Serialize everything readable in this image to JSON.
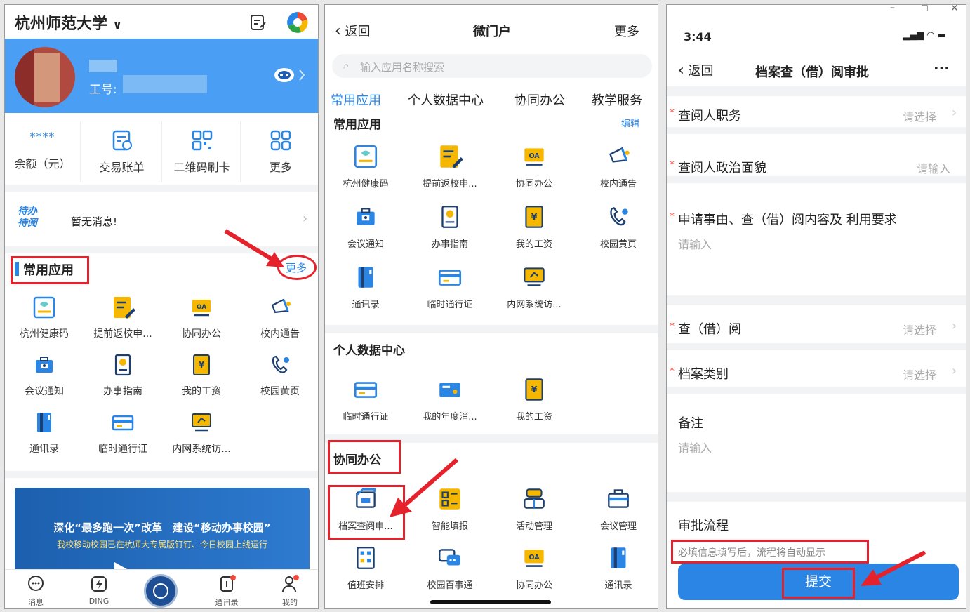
{
  "panel1": {
    "org_name": "杭州师范大学",
    "profile_id_label": "工号:",
    "wallet": [
      {
        "value": "****",
        "label": "余额（元）"
      },
      {
        "icon": "bill-icon",
        "label": "交易账单"
      },
      {
        "icon": "qrcode-icon",
        "label": "二维码刷卡"
      },
      {
        "icon": "grid-icon",
        "label": "更多"
      }
    ],
    "todo_badge_line1": "待办",
    "todo_badge_line2": "待阅",
    "todo_text": "暂无消息!",
    "section_title": "常用应用",
    "more_link": "更多",
    "apps": [
      {
        "label": "杭州健康码",
        "icon": "health-code-icon"
      },
      {
        "label": "提前返校申...",
        "icon": "form-edit-icon"
      },
      {
        "label": "协同办公",
        "icon": "oa-icon"
      },
      {
        "label": "校内通告",
        "icon": "megaphone-icon"
      },
      {
        "label": "会议通知",
        "icon": "briefcase-icon"
      },
      {
        "label": "办事指南",
        "icon": "guide-icon"
      },
      {
        "label": "我的工资",
        "icon": "salary-icon"
      },
      {
        "label": "校园黄页",
        "icon": "phone-icon"
      },
      {
        "label": "通讯录",
        "icon": "contacts-book-icon"
      },
      {
        "label": "临时通行证",
        "icon": "card-icon"
      },
      {
        "label": "内网系统访...",
        "icon": "monitor-icon"
      }
    ],
    "banner_line1": "深化“最多跑一次”改革　建设“移动办事校园”",
    "banner_line2": "我校移动校园已在杭师大专属版钉钉、今日校园上线运行",
    "tabbar": [
      {
        "label": "消息",
        "icon": "message-icon"
      },
      {
        "label": "DING",
        "icon": "ding-icon"
      },
      {
        "label": "",
        "icon": "school-logo-icon"
      },
      {
        "label": "通讯录",
        "icon": "contacts-icon"
      },
      {
        "label": "我的",
        "icon": "profile-icon"
      }
    ]
  },
  "panel2": {
    "back": "返回",
    "title": "微门户",
    "more": "更多",
    "search_placeholder": "输入应用名称搜索",
    "tabs": [
      "常用应用",
      "个人数据中心",
      "协同办公",
      "教学服务"
    ],
    "section1_title": "常用应用",
    "section1_edit": "编辑",
    "section1_apps": [
      {
        "label": "杭州健康码",
        "icon": "health-code-icon"
      },
      {
        "label": "提前返校申...",
        "icon": "form-edit-icon"
      },
      {
        "label": "协同办公",
        "icon": "oa-icon"
      },
      {
        "label": "校内通告",
        "icon": "megaphone-icon"
      },
      {
        "label": "会议通知",
        "icon": "briefcase-icon"
      },
      {
        "label": "办事指南",
        "icon": "guide-icon"
      },
      {
        "label": "我的工资",
        "icon": "salary-icon"
      },
      {
        "label": "校园黄页",
        "icon": "phone-icon"
      },
      {
        "label": "通讯录",
        "icon": "contacts-book-icon"
      },
      {
        "label": "临时通行证",
        "icon": "card-icon"
      },
      {
        "label": "内网系统访...",
        "icon": "monitor-icon"
      }
    ],
    "section2_title": "个人数据中心",
    "section2_apps": [
      {
        "label": "临时通行证",
        "icon": "card-icon"
      },
      {
        "label": "我的年度消...",
        "icon": "consumption-icon"
      },
      {
        "label": "我的工资",
        "icon": "salary-icon"
      }
    ],
    "section3_title": "协同办公",
    "section3_apps": [
      {
        "label": "档案查阅申...",
        "icon": "archive-icon"
      },
      {
        "label": "智能填报",
        "icon": "smart-form-icon"
      },
      {
        "label": "活动管理",
        "icon": "activity-icon"
      },
      {
        "label": "会议管理",
        "icon": "meeting-icon"
      },
      {
        "label": "值班安排",
        "icon": "duty-icon"
      },
      {
        "label": "校园百事通",
        "icon": "chat-icon"
      },
      {
        "label": "协同办公",
        "icon": "oa-icon"
      },
      {
        "label": "通讯录",
        "icon": "contacts-book-icon"
      }
    ]
  },
  "panel3": {
    "time": "3:44",
    "back": "返回",
    "title": "档案查（借）阅审批",
    "menu": "···",
    "fields": [
      {
        "label": "查阅人职务",
        "value": "请选择",
        "required": true,
        "chevron": true
      },
      {
        "label": "查阅人政治面貌",
        "value": "请输入",
        "required": true,
        "chevron": false
      },
      {
        "label": "申请事由、查（借）阅内容及 利用要求",
        "value": "请输入",
        "required": true,
        "multiline": true
      },
      {
        "label": "查（借）阅",
        "value": "请选择",
        "required": true,
        "chevron": true
      },
      {
        "label": "档案类别",
        "value": "请选择",
        "required": true,
        "chevron": true
      },
      {
        "label": "备注",
        "value": "请输入",
        "required": false,
        "multiline": true
      }
    ],
    "flow_title": "审批流程",
    "flow_hint": "必填信息填写后，流程将自动显示",
    "submit": "提交"
  },
  "colors": {
    "brand_blue": "#2b85e4",
    "header_blue": "#4a9ff5",
    "annotation_red": "#e5222b",
    "required_red": "#f04a3a"
  }
}
